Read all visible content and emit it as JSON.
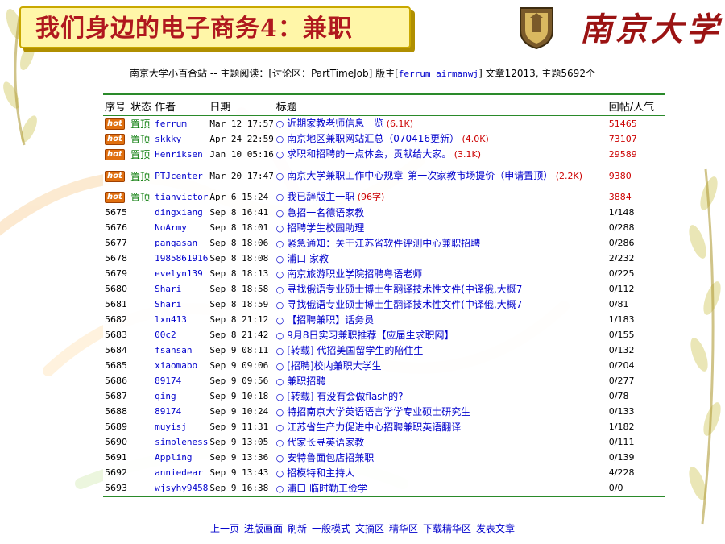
{
  "slide_title": "我们身边的电子商务4：兼职",
  "logo_text": "南京大学",
  "header": {
    "prefix": "南京大学小百合站 -- 主题阅读：[讨论区：PartTimeJob] 版主[",
    "moderators": "ferrum airmanwj",
    "suffix": "] 文章12013, 主题5692个"
  },
  "columns": {
    "num": "序号",
    "status": "状态",
    "author": "作者",
    "date": "日期",
    "title": "标题",
    "replies": "回帖/人气"
  },
  "pinned": [
    {
      "hot": "hot",
      "status": "置顶",
      "author": "ferrum",
      "date": "Mar 12 17:57",
      "title": "近期家教老师信息一览",
      "count": "(6.1K)",
      "replies": "51465"
    },
    {
      "hot": "hot",
      "status": "置顶",
      "author": "skkky",
      "date": "Apr 24 22:59",
      "title": "南京地区兼职网站汇总（070416更新）",
      "count": "(4.0K)",
      "replies": "73107"
    },
    {
      "hot": "hot",
      "status": "置顶",
      "author": "Henriksen",
      "date": "Jan 10 05:16",
      "title": "求职和招聘的一点体会，贡献给大家。",
      "count": "(3.1K)",
      "replies": "29589"
    },
    {
      "hot": "hot",
      "status": "置顶",
      "author": "PTJcenter",
      "date": "Mar 20 17:47",
      "title": "南京大学兼职工作中心规章_第一次家教市场提价（申请置顶）",
      "count": "(2.2K)",
      "replies": "9380"
    },
    {
      "hot": "hot",
      "status": "置顶",
      "author": "tianvictor",
      "date": "Apr 6 15:24",
      "title": "我已辞版主一职",
      "count": "(96字)",
      "replies": "3884"
    }
  ],
  "rows": [
    {
      "num": "5675",
      "author": "dingxiang",
      "date": "Sep 8 16:41",
      "title": "急招一名德语家教",
      "replies": "1/148"
    },
    {
      "num": "5676",
      "author": "NoArmy",
      "date": "Sep 8 18:01",
      "title": "招聘学生校园助理",
      "replies": "0/288"
    },
    {
      "num": "5677",
      "author": "pangasan",
      "date": "Sep 8 18:06",
      "title": "紧急通知：关于江苏省软件评测中心兼职招聘",
      "replies": "0/286"
    },
    {
      "num": "5678",
      "author": "1985861916",
      "date": "Sep 8 18:08",
      "title": "浦口 家教",
      "replies": "2/232"
    },
    {
      "num": "5679",
      "author": "evelyn139",
      "date": "Sep 8 18:13",
      "title": "南京旅游职业学院招聘粤语老师",
      "replies": "0/225"
    },
    {
      "num": "5680",
      "author": "Shari",
      "date": "Sep 8 18:58",
      "title": "寻找俄语专业硕士博士生翻译技术性文件(中译俄,大概7",
      "replies": "0/112"
    },
    {
      "num": "5681",
      "author": "Shari",
      "date": "Sep 8 18:59",
      "title": "寻找俄语专业硕士博士生翻译技术性文件(中译俄,大概7",
      "replies": "0/81"
    },
    {
      "num": "5682",
      "author": "lxn413",
      "date": "Sep 8 21:12",
      "title": "【招聘兼职】话务员",
      "replies": "1/183"
    },
    {
      "num": "5683",
      "author": "00c2",
      "date": "Sep 8 21:42",
      "title": "9月8日实习兼职推荐【应届生求职网】",
      "replies": "0/155"
    },
    {
      "num": "5684",
      "author": "fsansan",
      "date": "Sep 9 08:11",
      "title": "[转载] 代招美国留学生的陪住生",
      "replies": "0/132"
    },
    {
      "num": "5685",
      "author": "xiaomabo",
      "date": "Sep 9 09:06",
      "title": "[招聘]校内兼职大学生",
      "replies": "0/204"
    },
    {
      "num": "5686",
      "author": "89174",
      "date": "Sep 9 09:56",
      "title": "兼职招聘",
      "replies": "0/277"
    },
    {
      "num": "5687",
      "author": "qing",
      "date": "Sep 9 10:18",
      "title": "[转载] 有没有会做flash的?",
      "replies": "0/78"
    },
    {
      "num": "5688",
      "author": "89174",
      "date": "Sep 9 10:24",
      "title": "特招南京大学英语语言学学专业硕士研究生",
      "replies": "0/133"
    },
    {
      "num": "5689",
      "author": "muyisj",
      "date": "Sep 9 11:31",
      "title": "江苏省生产力促进中心招聘兼职英语翻译",
      "replies": "1/182"
    },
    {
      "num": "5690",
      "author": "simpleness",
      "date": "Sep 9 13:05",
      "title": "代家长寻英语家教",
      "replies": "0/111"
    },
    {
      "num": "5691",
      "author": "Appling",
      "date": "Sep 9 13:36",
      "title": "安特鲁面包店招兼职",
      "replies": "0/139"
    },
    {
      "num": "5692",
      "author": "anniedear",
      "date": "Sep 9 13:43",
      "title": "招模特和主持人",
      "replies": "4/228"
    },
    {
      "num": "5693",
      "author": "wjsyhy9458",
      "date": "Sep 9 16:38",
      "title": "浦口  临时勤工俭学",
      "replies": "0/0"
    }
  ],
  "footer_links": [
    "上一页",
    "进版画面",
    "刷新",
    "一般模式",
    "文摘区",
    "精华区",
    "下载精华区",
    "发表文章"
  ],
  "colors": {
    "accent_red": "#b0181e",
    "link_blue": "#0000cc",
    "rule_green": "#2a8a2a"
  }
}
